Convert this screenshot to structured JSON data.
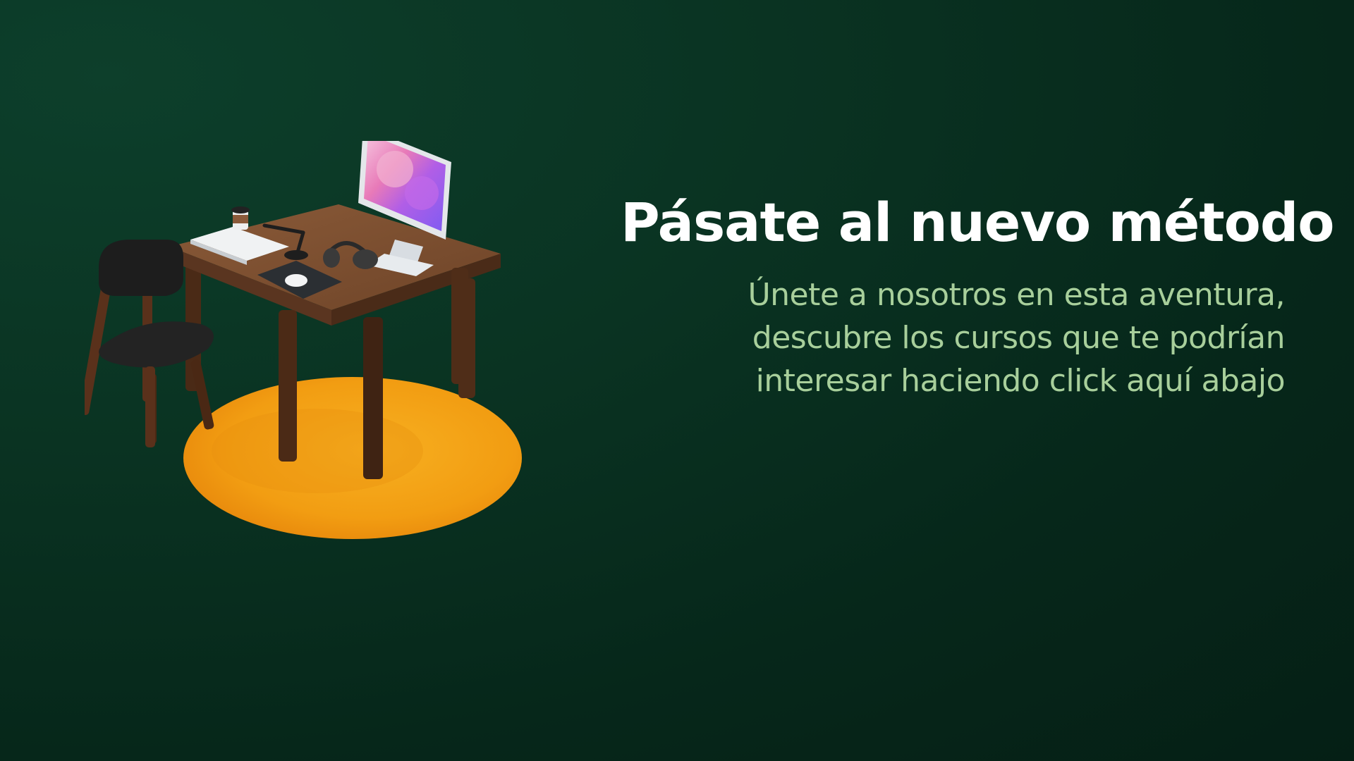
{
  "hero": {
    "title": "Pásate al nuevo método",
    "subtitle_lines": [
      "Únete a nosotros en esta aventura,",
      "descubre los cursos que te podrían",
      "interesar haciendo click aquí abajo"
    ],
    "illustration": "desk-workspace-illustration"
  },
  "colors": {
    "background": "#0a3322",
    "title": "#ffffff",
    "subtitle": "#a8cf9b",
    "rug": "#f5a317"
  }
}
